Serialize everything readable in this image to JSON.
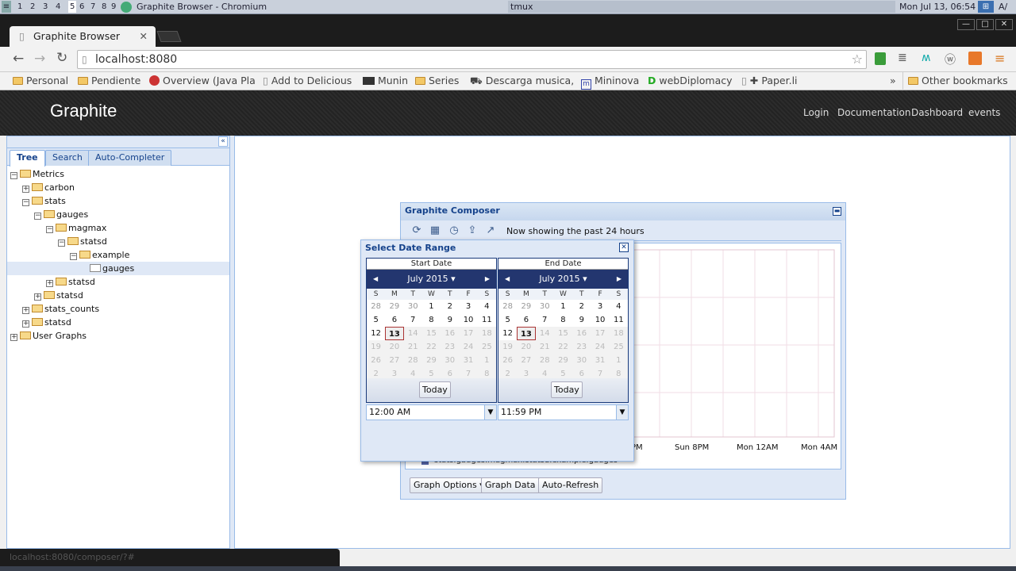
{
  "taskbar": {
    "workspaces": [
      "1",
      "2",
      "3",
      "4",
      "5",
      "6",
      "7",
      "8",
      "9"
    ],
    "window_title": "Graphite Browser - Chromium",
    "center": "tmux",
    "clock": "Mon Jul 13, 06:54",
    "right_cut": "A/"
  },
  "browser": {
    "tab_title": "Graphite Browser",
    "url": "localhost:8080",
    "bookmarks": [
      "Personal",
      "Pendiente",
      "Overview (Java Pla",
      "Add to Delicious",
      "Munin",
      "Series",
      "Descarga musica,",
      "Mininova",
      "webDiplomacy",
      "✚ Paper.li"
    ],
    "more": "»",
    "other_bookmarks": "Other bookmarks",
    "status_url": "localhost:8080/composer/?#"
  },
  "graphite": {
    "logo": "Graphite",
    "nav": [
      "Login",
      "Documentation",
      "Dashboard",
      "events"
    ]
  },
  "left_panel": {
    "tabs": [
      "Tree",
      "Search",
      "Auto-Completer"
    ],
    "tree": [
      {
        "label": "Metrics",
        "depth": 0,
        "toggle": "−"
      },
      {
        "label": "carbon",
        "depth": 1,
        "toggle": "+"
      },
      {
        "label": "stats",
        "depth": 1,
        "toggle": "−"
      },
      {
        "label": "gauges",
        "depth": 2,
        "toggle": "−"
      },
      {
        "label": "magmax",
        "depth": 3,
        "toggle": "−"
      },
      {
        "label": "statsd",
        "depth": 4,
        "toggle": "−"
      },
      {
        "label": "example",
        "depth": 5,
        "toggle": "−"
      },
      {
        "label": "gauges",
        "depth": 6,
        "toggle": "",
        "leaf": true
      },
      {
        "label": "statsd",
        "depth": 3,
        "toggle": "+"
      },
      {
        "label": "statsd",
        "depth": 2,
        "toggle": "+"
      },
      {
        "label": "stats_counts",
        "depth": 1,
        "toggle": "+"
      },
      {
        "label": "statsd",
        "depth": 1,
        "toggle": "+"
      },
      {
        "label": "User Graphs",
        "depth": 0,
        "toggle": "+"
      }
    ]
  },
  "composer": {
    "title": "Graphite Composer",
    "showing": "Now showing the past 24 hours",
    "x_labels": [
      "PM",
      "Sun 8PM",
      "Mon 12AM",
      "Mon 4AM"
    ],
    "legend": "stats.gauges.magmax.statsd.example.gauges",
    "buttons": [
      "Graph Options ▾",
      "Graph Data",
      "Auto-Refresh"
    ]
  },
  "date_dialog": {
    "title": "Select Date Range",
    "start_label": "Start Date",
    "end_label": "End Date",
    "month": "July 2015",
    "dow": [
      "S",
      "M",
      "T",
      "W",
      "T",
      "F",
      "S"
    ],
    "days": [
      "28",
      "29",
      "30",
      "1",
      "2",
      "3",
      "4",
      "5",
      "6",
      "7",
      "8",
      "9",
      "10",
      "11",
      "12",
      "13",
      "14",
      "15",
      "16",
      "17",
      "18",
      "19",
      "20",
      "21",
      "22",
      "23",
      "24",
      "25",
      "26",
      "27",
      "28",
      "29",
      "30",
      "31",
      "1",
      "2",
      "3",
      "4",
      "5",
      "6",
      "7",
      "8"
    ],
    "today_index": 15,
    "first_enabled": 3,
    "last_enabled": 15,
    "prev_month_days": 3,
    "today_label": "Today",
    "start_time": "12:00 AM",
    "end_time": "11:59 PM"
  }
}
